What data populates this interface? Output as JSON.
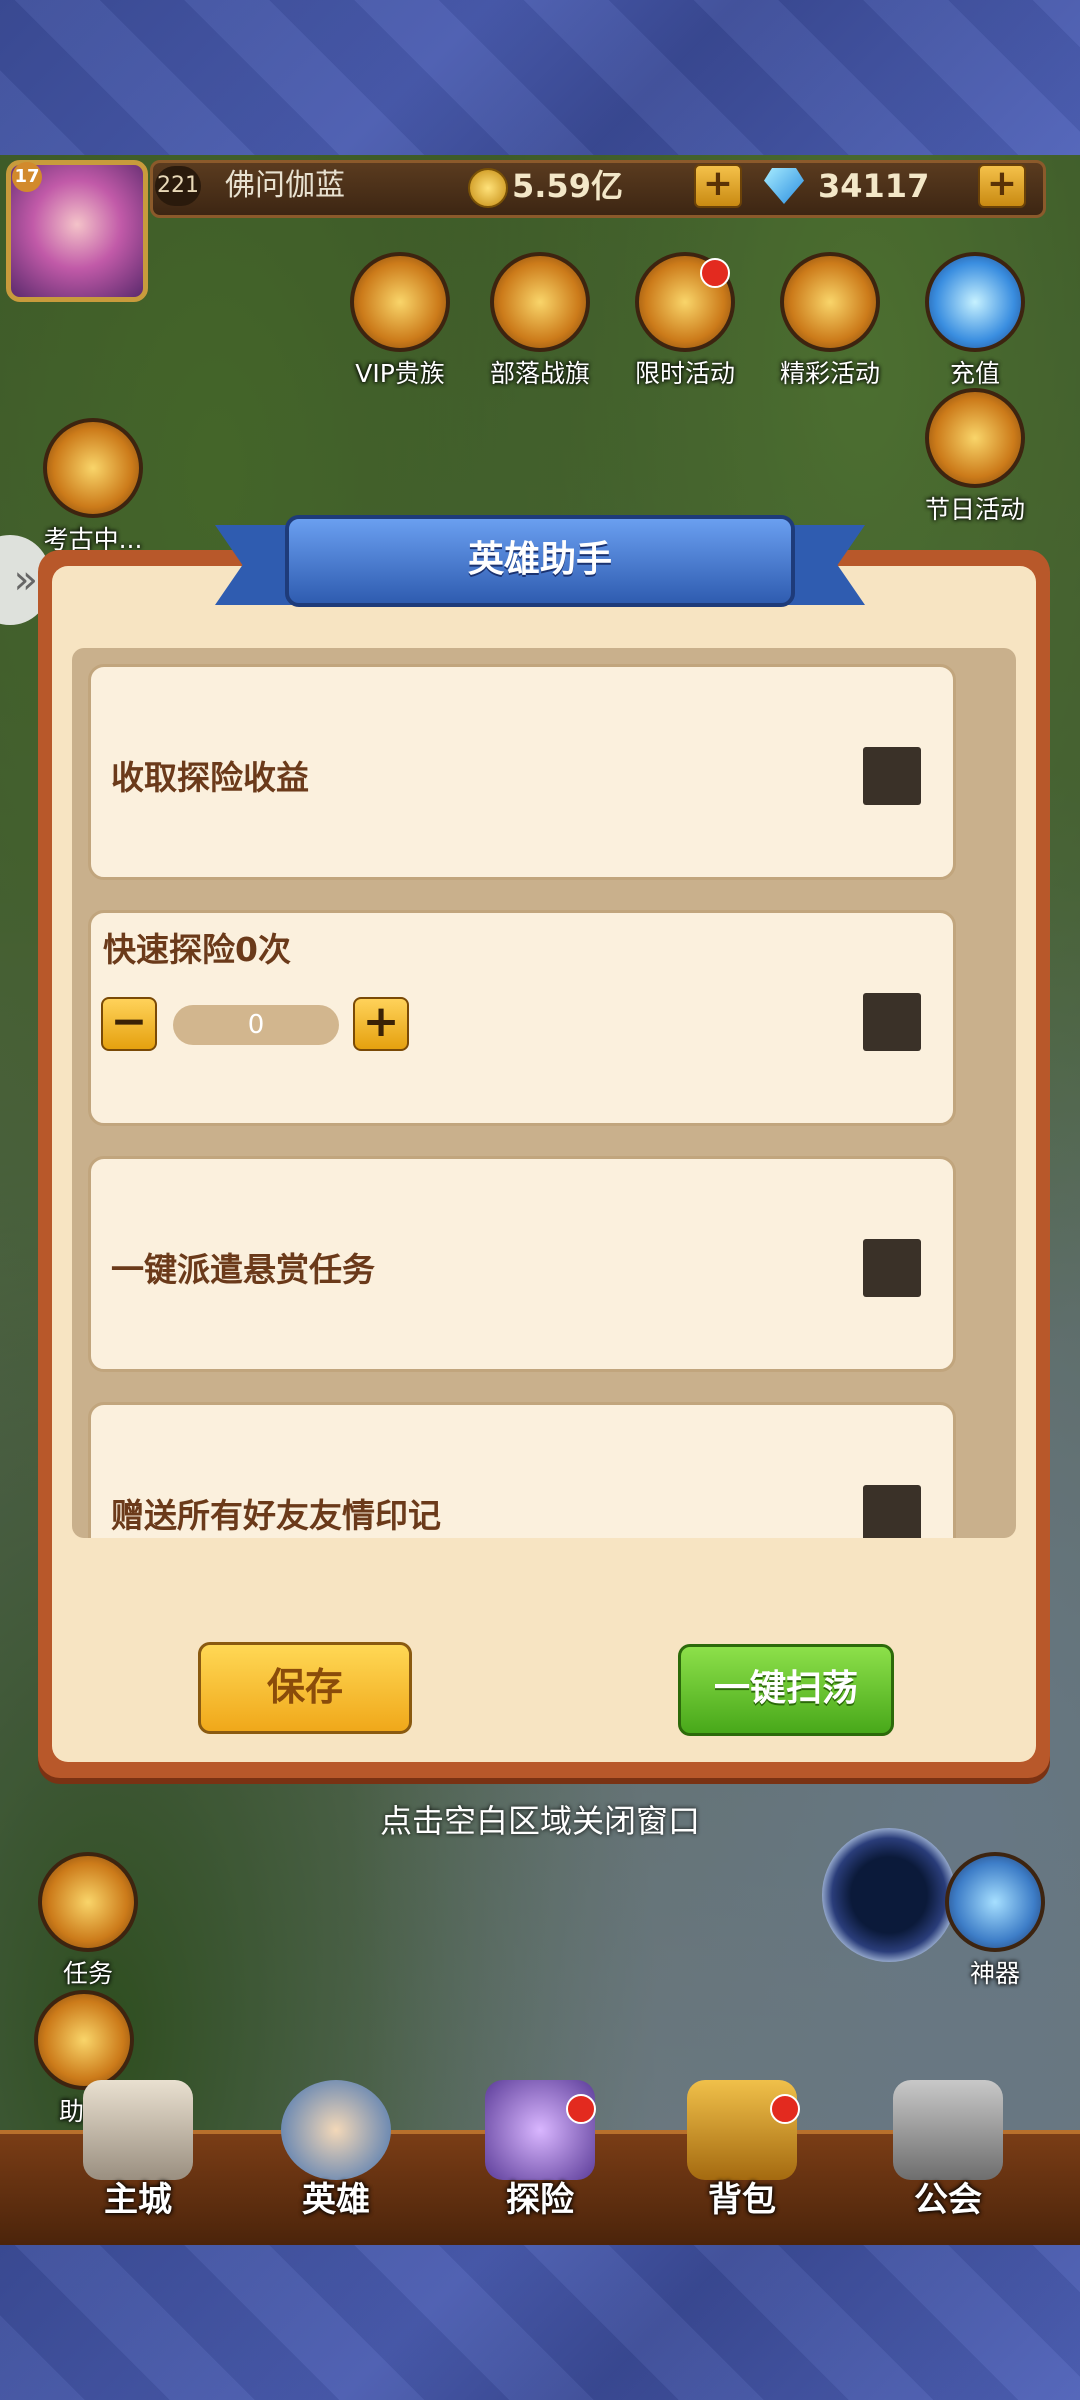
{
  "player": {
    "level": "17",
    "vip_level": "221",
    "name": "佛问伽蓝",
    "gold": "5.59亿",
    "gems": "34117"
  },
  "activities": {
    "vip": "VIP贵族",
    "tribe": "部落战旗",
    "limited": "限时活动",
    "wonderful": "精彩活动",
    "recharge": "充值",
    "festival": "节日活动",
    "archaeology": "考古中..."
  },
  "dialog": {
    "title": "英雄助手",
    "rows": [
      {
        "label": "收取探险收益"
      },
      {
        "label": "快速探险0次",
        "stepper_value": "0"
      },
      {
        "label": "一键派遣悬赏任务"
      },
      {
        "label": "赠送所有好友友情印记"
      }
    ],
    "save_label": "保存",
    "sweep_label": "一键扫荡"
  },
  "close_hint": "点击空白区域关闭窗口",
  "side": {
    "task": "任务",
    "helper": "助手",
    "artifact": "神器"
  },
  "nav": {
    "city": "主城",
    "hero": "英雄",
    "explore": "探险",
    "bag": "背包",
    "guild": "公会"
  },
  "icons": {
    "plus": "+",
    "minus": "−",
    "arrow": "»"
  }
}
